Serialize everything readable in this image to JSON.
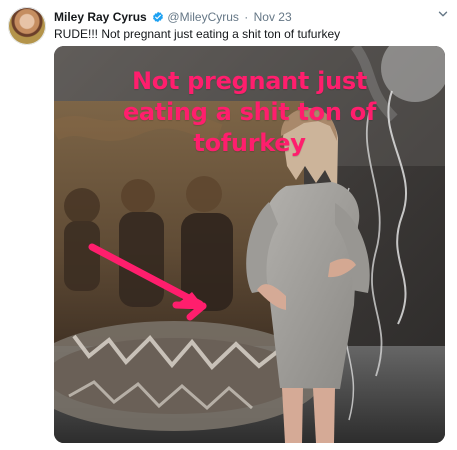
{
  "tweet": {
    "display_name": "Miley Ray Cyrus",
    "handle": "@MileyCyrus",
    "separator": "·",
    "date": "Nov 23",
    "text": "RUDE!!! Not pregnant just eating a shit ton of tufurkey",
    "verified_icon": "verified-badge-icon",
    "menu_icon": "chevron-down-icon"
  },
  "media": {
    "caption_lines": [
      "Not pregnant just",
      "eating a shit ton of",
      "tofurkey"
    ],
    "caption_color": "#ff1e6d",
    "arrow_color": "#ff1e6d"
  }
}
